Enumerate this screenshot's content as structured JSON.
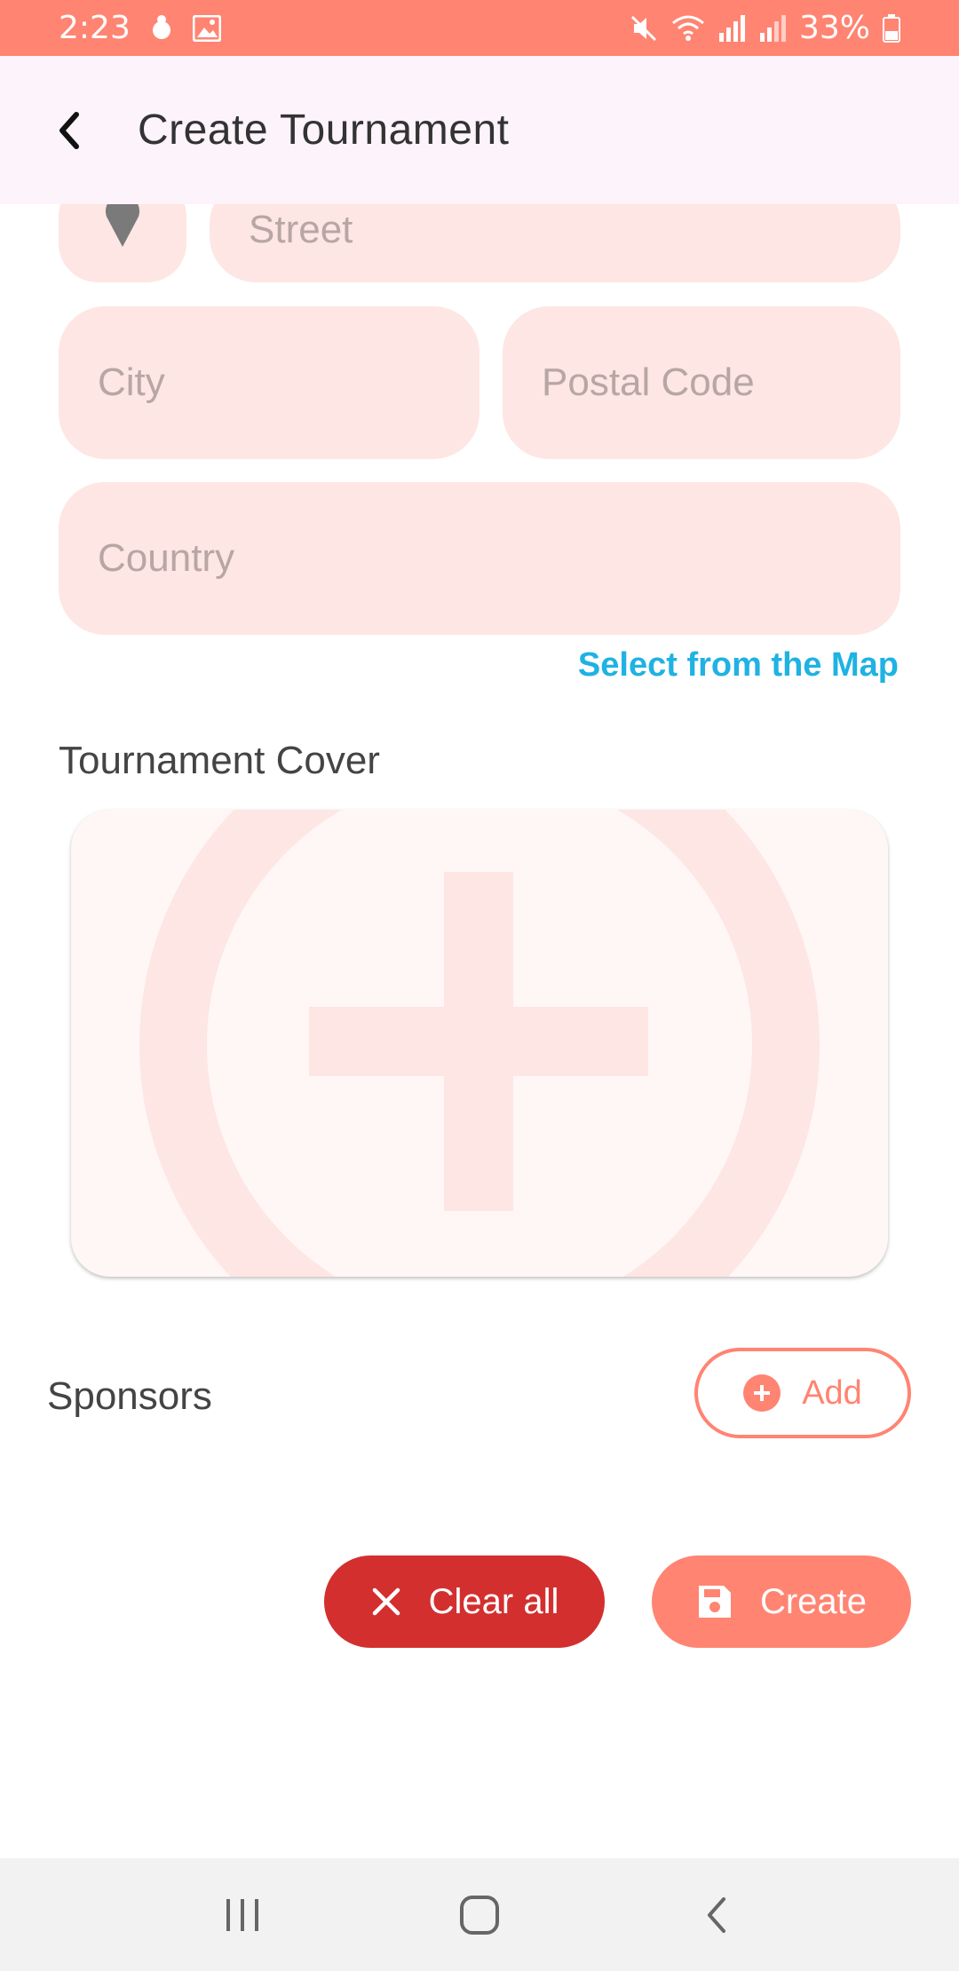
{
  "status_bar": {
    "time": "2:23",
    "battery": "33%",
    "icons": [
      "notification-icon",
      "gallery-icon",
      "mute-icon",
      "wifi-icon",
      "signal-icon",
      "signal-2-icon",
      "battery-icon"
    ]
  },
  "app_bar": {
    "title": "Create Tournament",
    "back_icon": "chevron-left-icon"
  },
  "address": {
    "street_placeholder": "Street",
    "city_placeholder": "City",
    "postal_placeholder": "Postal Code",
    "country_placeholder": "Country",
    "map_link": "Select from the Map",
    "location_icon": "map-pin-icon"
  },
  "cover": {
    "label": "Tournament Cover",
    "icon": "add-circle-icon"
  },
  "sponsors": {
    "label": "Sponsors",
    "add_label": "Add"
  },
  "actions": {
    "clear_label": "Clear all",
    "create_label": "Create"
  },
  "colors": {
    "accent": "#ff8472",
    "danger": "#d32f2f",
    "field_bg": "#fde6e3",
    "link": "#1fb2e3",
    "app_bar_bg": "#fdf3fa"
  },
  "nav_bar": {
    "icons": [
      "recents-icon",
      "home-icon",
      "back-icon"
    ]
  }
}
